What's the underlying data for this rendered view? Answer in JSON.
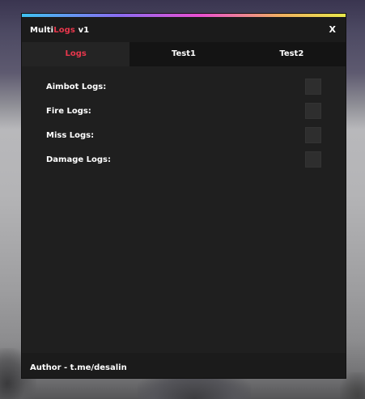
{
  "window": {
    "title_prefix": "Multi",
    "title_accent": "Logs",
    "title_suffix": " v1",
    "close_label": "X",
    "accent_color": "#e8374c",
    "gradient_colors": [
      "#3ec1f0",
      "#8a6cf0",
      "#e84fd0",
      "#f0b060",
      "#e8e84a"
    ]
  },
  "tabs": [
    {
      "label": "Logs",
      "active": true
    },
    {
      "label": "Test1",
      "active": false
    },
    {
      "label": "Test2",
      "active": false
    }
  ],
  "options": [
    {
      "label": "Aimbot Logs:",
      "checked": false
    },
    {
      "label": "Fire Logs:",
      "checked": false
    },
    {
      "label": "Miss Logs:",
      "checked": false
    },
    {
      "label": "Damage Logs:",
      "checked": false
    }
  ],
  "footer": {
    "author": "Author - t.me/desalin"
  }
}
